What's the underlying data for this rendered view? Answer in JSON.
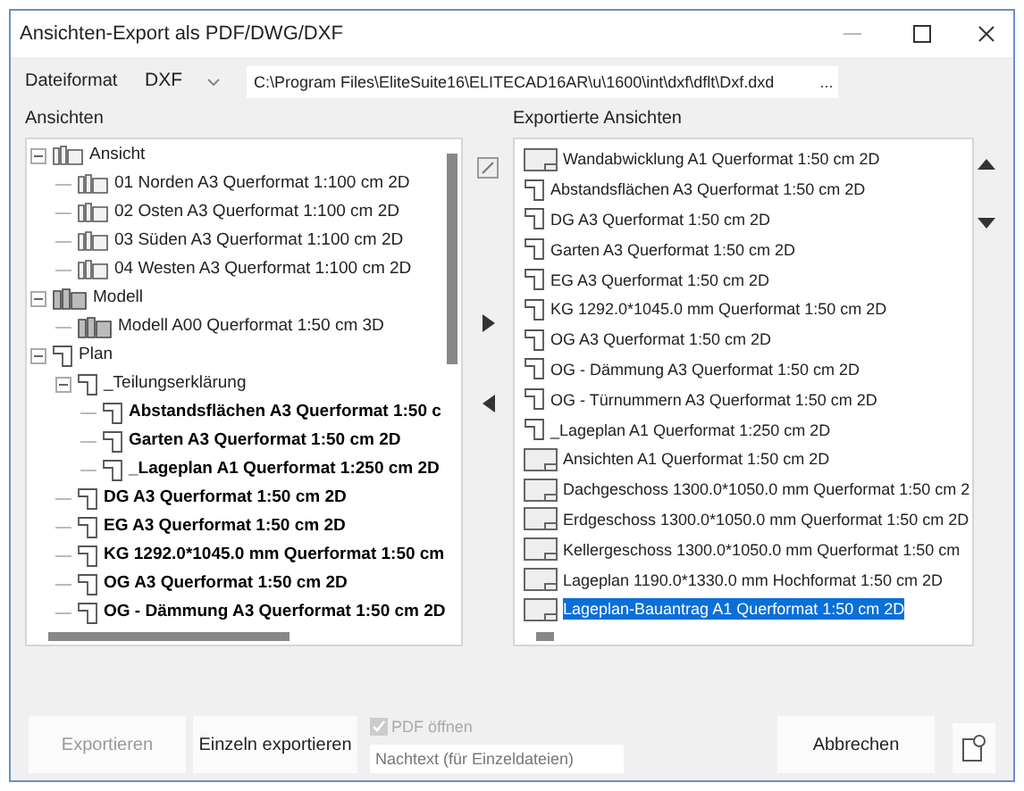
{
  "window": {
    "title": "Ansichten-Export als PDF/DWG/DXF"
  },
  "format": {
    "label": "Dateiformat",
    "value": "DXF",
    "path": "C:\\Program Files\\EliteSuite16\\ELITECAD16AR\\u\\1600\\int\\dxf\\dflt\\Dxf.dxd",
    "browse": "..."
  },
  "views": {
    "label": "Ansichten",
    "tree": [
      {
        "label": "Ansicht",
        "kind": "ansicht",
        "exported": false,
        "expanded": true,
        "children": [
          {
            "label": "01 Norden A3 Querformat 1:100 cm 2D",
            "kind": "ansicht",
            "exported": false
          },
          {
            "label": "02 Osten A3 Querformat 1:100 cm 2D",
            "kind": "ansicht",
            "exported": false
          },
          {
            "label": "03 Süden A3 Querformat 1:100 cm 2D",
            "kind": "ansicht",
            "exported": false
          },
          {
            "label": "04 Westen A3 Querformat 1:100 cm 2D",
            "kind": "ansicht",
            "exported": false
          }
        ]
      },
      {
        "label": "Modell",
        "kind": "modell",
        "exported": false,
        "expanded": true,
        "children": [
          {
            "label": "Modell A00 Querformat 1:50 cm 3D",
            "kind": "modell",
            "exported": false
          }
        ]
      },
      {
        "label": "Plan",
        "kind": "plan",
        "exported": false,
        "expanded": true,
        "children": [
          {
            "label": "_Teilungserklärung",
            "kind": "plan",
            "exported": false,
            "expanded": true,
            "children": [
              {
                "label": "Abstandsflächen A3 Querformat 1:50 c",
                "kind": "plan",
                "exported": true
              },
              {
                "label": "Garten A3 Querformat 1:50 cm 2D",
                "kind": "plan",
                "exported": true
              },
              {
                "label": "_Lageplan A1 Querformat 1:250 cm 2D",
                "kind": "plan",
                "exported": true
              }
            ]
          },
          {
            "label": "DG A3 Querformat 1:50 cm 2D",
            "kind": "plan",
            "exported": true
          },
          {
            "label": "EG A3 Querformat 1:50 cm 2D",
            "kind": "plan",
            "exported": true
          },
          {
            "label": "KG 1292.0*1045.0 mm Querformat 1:50 cm",
            "kind": "plan",
            "exported": true
          },
          {
            "label": "OG A3 Querformat 1:50 cm 2D",
            "kind": "plan",
            "exported": true
          },
          {
            "label": "OG - Dämmung A3 Querformat 1:50 cm 2D",
            "kind": "plan",
            "exported": true
          }
        ]
      }
    ]
  },
  "exported": {
    "label": "Exportierte Ansichten",
    "items": [
      {
        "label": "Wandabwicklung A1 Querformat 1:50 cm 2D",
        "kind": "sheet",
        "selected": false
      },
      {
        "label": "Abstandsflächen A3 Querformat 1:50 cm 2D",
        "kind": "plan",
        "selected": false
      },
      {
        "label": "DG A3 Querformat 1:50 cm 2D",
        "kind": "plan",
        "selected": false
      },
      {
        "label": "Garten A3 Querformat 1:50 cm 2D",
        "kind": "plan",
        "selected": false
      },
      {
        "label": "EG A3 Querformat 1:50 cm 2D",
        "kind": "plan",
        "selected": false
      },
      {
        "label": "KG 1292.0*1045.0 mm Querformat 1:50 cm 2D",
        "kind": "plan",
        "selected": false
      },
      {
        "label": "OG A3 Querformat 1:50 cm 2D",
        "kind": "plan",
        "selected": false
      },
      {
        "label": "OG - Dämmung A3 Querformat 1:50 cm 2D",
        "kind": "plan",
        "selected": false
      },
      {
        "label": "OG - Türnummern A3 Querformat 1:50 cm 2D",
        "kind": "plan",
        "selected": false
      },
      {
        "label": "_Lageplan A1 Querformat 1:250 cm 2D",
        "kind": "plan",
        "selected": false
      },
      {
        "label": "Ansichten A1 Querformat 1:50 cm 2D",
        "kind": "sheet",
        "selected": false
      },
      {
        "label": "Dachgeschoss 1300.0*1050.0 mm Querformat 1:50 cm 2",
        "kind": "sheet",
        "selected": false
      },
      {
        "label": "Erdgeschoss 1300.0*1050.0 mm Querformat 1:50 cm 2D",
        "kind": "sheet",
        "selected": false
      },
      {
        "label": "Kellergeschoss 1300.0*1050.0 mm Querformat 1:50 cm",
        "kind": "sheet",
        "selected": false
      },
      {
        "label": "Lageplan 1190.0*1330.0 mm Hochformat 1:50 cm 2D",
        "kind": "sheet",
        "selected": false
      },
      {
        "label": "Lageplan-Bauantrag A1 Querformat 1:50 cm 2D",
        "kind": "sheet",
        "selected": true
      }
    ]
  },
  "buttons": {
    "export": {
      "label": "Exportieren",
      "disabled": true
    },
    "single": {
      "label": "Einzeln exportieren",
      "disabled": false
    },
    "cancel": {
      "label": "Abbrechen",
      "disabled": false
    }
  },
  "pdf_open": {
    "label": "PDF öffnen",
    "checked": true,
    "disabled": true
  },
  "suffix": {
    "placeholder": "Nachtext (für Einzeldateien)"
  }
}
